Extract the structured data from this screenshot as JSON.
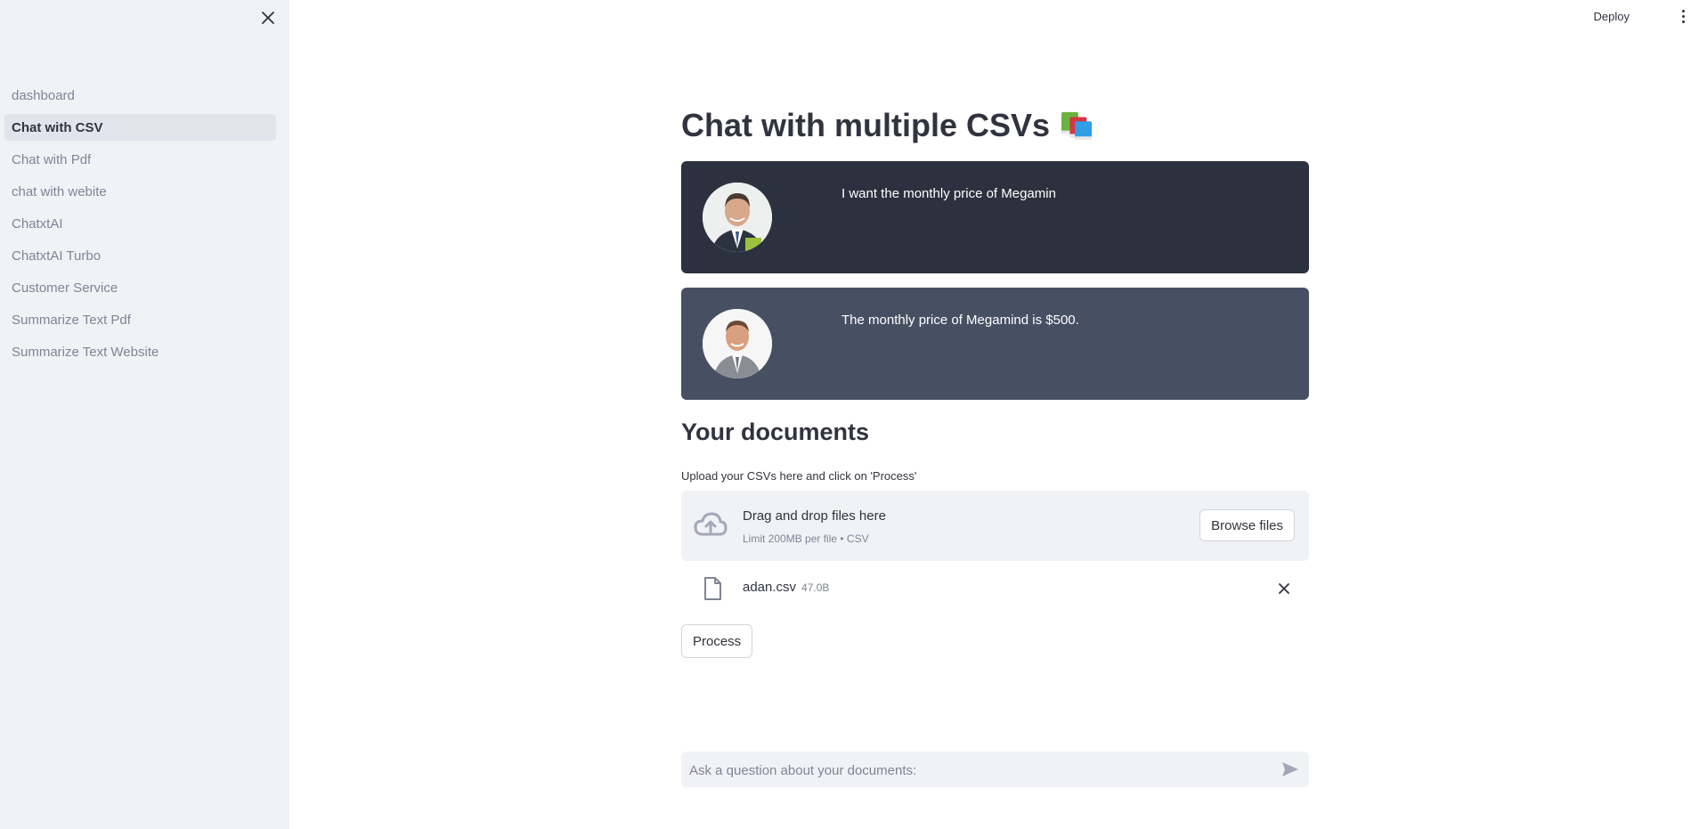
{
  "sidebar": {
    "close_icon": "close-icon",
    "items": [
      {
        "label": "dashboard",
        "active": false
      },
      {
        "label": "Chat with CSV",
        "active": true
      },
      {
        "label": "Chat with Pdf",
        "active": false
      },
      {
        "label": "chat with webite",
        "active": false
      },
      {
        "label": "ChatxtAI",
        "active": false
      },
      {
        "label": "ChatxtAI Turbo",
        "active": false
      },
      {
        "label": "Customer Service",
        "active": false
      },
      {
        "label": "Summarize Text Pdf",
        "active": false
      },
      {
        "label": "Summarize Text Website",
        "active": false
      }
    ]
  },
  "header": {
    "deploy_label": "Deploy",
    "menu_icon": "more-vertical-icon"
  },
  "main": {
    "title": "Chat with multiple CSVs",
    "title_icon": "books-emoji",
    "messages": [
      {
        "role": "user",
        "text": "I want the monthly price of Megamin",
        "background": "#2b313e"
      },
      {
        "role": "bot",
        "text": "The monthly price of Megamind is $500.",
        "background": "#475063"
      }
    ],
    "documents_title": "Your documents",
    "upload_label": "Upload your CSVs here and click on 'Process'",
    "dropzone": {
      "title": "Drag and drop files here",
      "subtitle": "Limit 200MB per file • CSV",
      "browse_label": "Browse files",
      "icon": "cloud-upload-icon"
    },
    "uploaded_file": {
      "name": "adan.csv",
      "size": "47.0B",
      "icon": "file-icon"
    },
    "process_label": "Process",
    "chat_input": {
      "placeholder": "Ask a question about your documents:",
      "value": ""
    }
  }
}
